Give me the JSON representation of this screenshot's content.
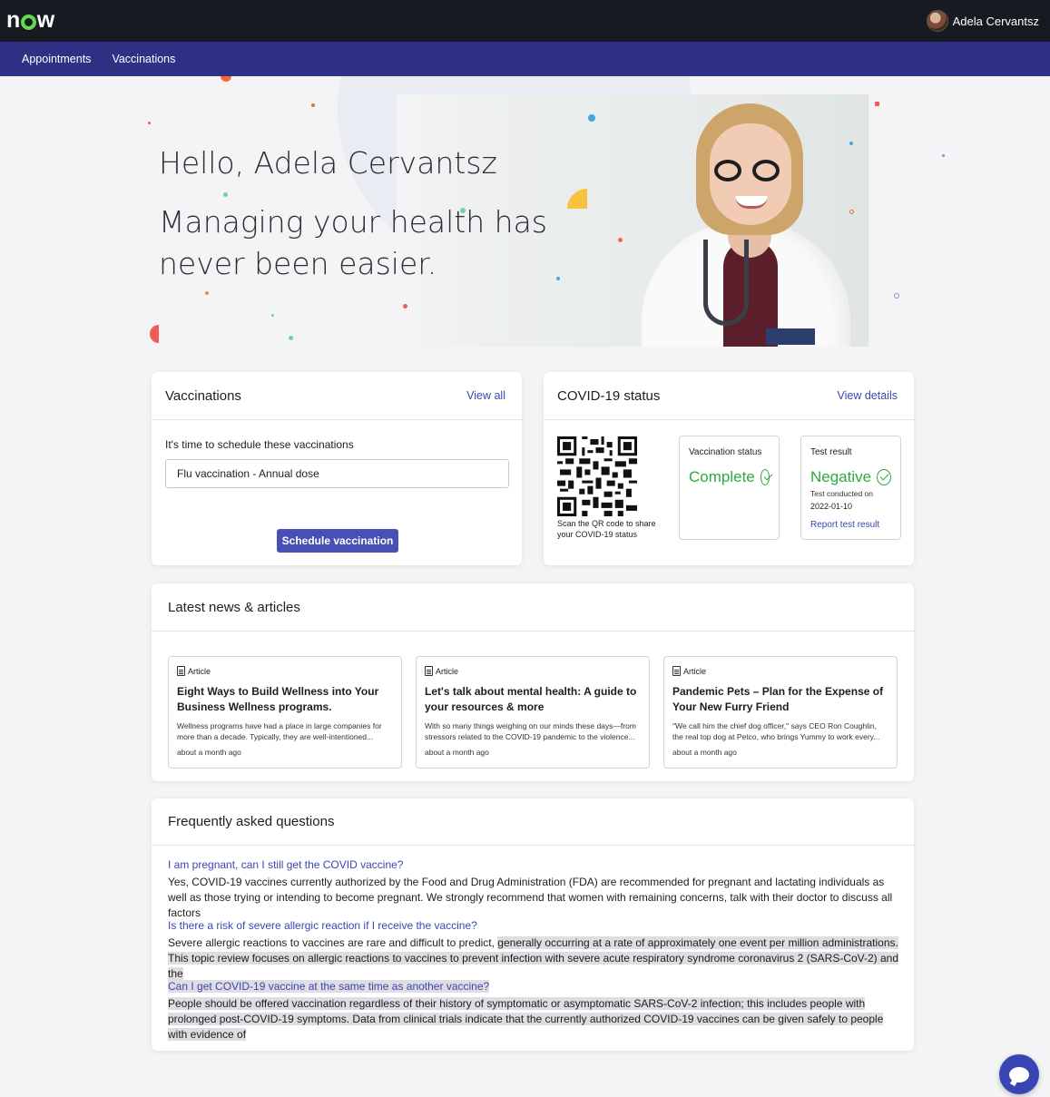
{
  "brand": {
    "logo_text": "now"
  },
  "user": {
    "name": "Adela Cervantsz"
  },
  "nav": {
    "items": [
      "Appointments",
      "Vaccinations"
    ]
  },
  "hero": {
    "greeting": "Hello, Adela Cervantsz",
    "tagline": "Managing your health has never been easier."
  },
  "vaccinations": {
    "title": "Vaccinations",
    "view_all": "View all",
    "intro": "It's time to schedule these vaccinations",
    "item": "Flu vaccination - Annual dose",
    "button": "Schedule vaccination"
  },
  "covid": {
    "title": "COVID-19 status",
    "view_details": "View details",
    "qr_caption": "Scan the QR code to share your COVID-19 status",
    "vaccination_label": "Vaccination status",
    "vaccination_value": "Complete",
    "test_label": "Test result",
    "test_value": "Negative",
    "test_conducted": "Test conducted on",
    "test_date": "2022-01-10",
    "report_link": "Report test result",
    "status_color": "#2ea842"
  },
  "news": {
    "title": "Latest news & articles",
    "articles": [
      {
        "type": "Article",
        "title": "Eight Ways to Build Wellness into Your Business Wellness programs.",
        "excerpt": "Wellness programs have had a place in large companies for more than a decade. Typically, they are well-intentioned...",
        "time": "about a month ago"
      },
      {
        "type": "Article",
        "title": "Let's talk about mental health: A guide to your resources & more",
        "excerpt": "With so many things weighing on our minds these days—from stressors related to the COVID-19 pandemic to the violence...",
        "time": "about a month ago"
      },
      {
        "type": "Article",
        "title": "Pandemic Pets – Plan for the Expense of Your New Furry Friend",
        "excerpt": "\"We call him the chief dog officer,\" says CEO Ron Coughlin, the real top dog at Petco, who brings Yummy to work every...",
        "time": "about a month ago"
      }
    ]
  },
  "faq": {
    "title": "Frequently asked questions",
    "items": [
      {
        "q": "I am pregnant, can I still get the COVID vaccine?",
        "a": "Yes, COVID-19 vaccines currently authorized by the Food and Drug Administration (FDA) are recommended for pregnant and lactating individuals as well as those trying or intending to become pregnant. We strongly recommend that women with remaining concerns, talk with their doctor to discuss all factors"
      },
      {
        "q": "Is there a risk of severe allergic reaction if I receive the vaccine?",
        "a_plain": "Severe allergic reactions to vaccines are rare and difficult to predict, ",
        "a_highlight": "generally occurring at a rate of approximately one event per million administrations. This topic review focuses on allergic reactions to vaccines to prevent infection with severe acute respiratory syndrome coronavirus 2 (SARS-CoV-2) and the"
      },
      {
        "q": "Can I get COVID-19 vaccine at the same time as another vaccine?",
        "a": "People should be offered vaccination regardless of their history of symptomatic or asymptomatic SARS-CoV-2 infection; this includes people with prolonged post-COVID-19 symptoms. Data from clinical trials indicate that the currently authorized COVID-19 vaccines can be given safely to people with evidence of"
      }
    ]
  },
  "colors": {
    "nav": "#2f3185",
    "topbar": "#171a21",
    "accent": "#4950b5",
    "link": "#3c46b2"
  },
  "icons": {
    "chat": "chat-icon",
    "article": "article-icon",
    "check": "check-circle-icon"
  }
}
